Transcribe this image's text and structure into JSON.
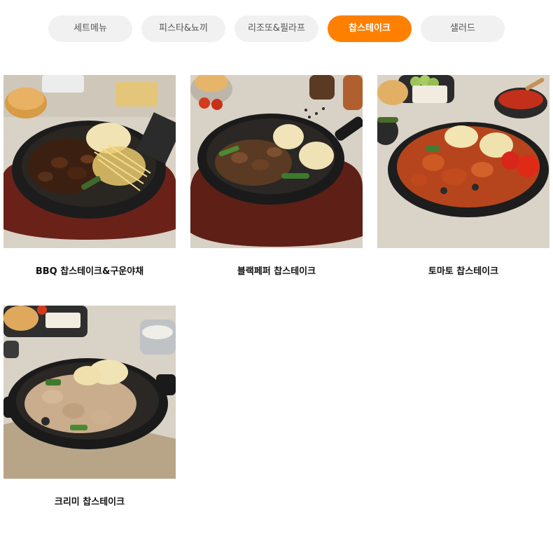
{
  "tabs": [
    {
      "label": "세트메뉴",
      "active": false
    },
    {
      "label": "피스타&뇨끼",
      "active": false
    },
    {
      "label": "리조또&필라프",
      "active": false
    },
    {
      "label": "찹스테이크",
      "active": true
    },
    {
      "label": "샐러드",
      "active": false
    }
  ],
  "menu_items": [
    {
      "name": "BBQ 찹스테이크&구운야채"
    },
    {
      "name": "블랙페퍼 찹스테이크"
    },
    {
      "name": "토마토 찹스테이크"
    },
    {
      "name": "크리미 찹스테이크"
    }
  ]
}
